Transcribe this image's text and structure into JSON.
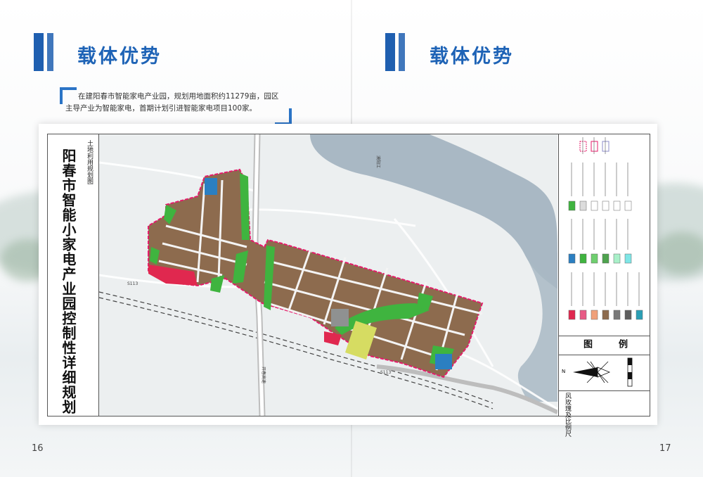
{
  "left_page": {
    "title": "载体优势",
    "intro_line1": "在建阳春市智能家电产业园，规划用地面积约11279亩，园区",
    "intro_line2": "主导产业为智能家电，首期计划引进智能家电项目100家。",
    "page_number": "16"
  },
  "right_page": {
    "title": "载体优势",
    "page_number": "17"
  },
  "map": {
    "title": "阳春市智能小家电产业园控制性详细规划",
    "subtitle": "土地利用规划图",
    "legend_title_1": "图",
    "legend_title_2": "例",
    "scale_label": "风玫瑰及比例尺",
    "north_label": "N",
    "road_label_1": "S113",
    "road_label_2": "S113",
    "road_label_3": "开春高速",
    "river_label": "漠阳江"
  },
  "colors": {
    "brand_blue": "#1e63b6",
    "industrial": "#8d6b4e",
    "green": "#3fb43f",
    "commercial": "#e0284f",
    "water": "#a9b8c4",
    "boundary": "#e51b6a",
    "yellow": "#d6dc62"
  }
}
